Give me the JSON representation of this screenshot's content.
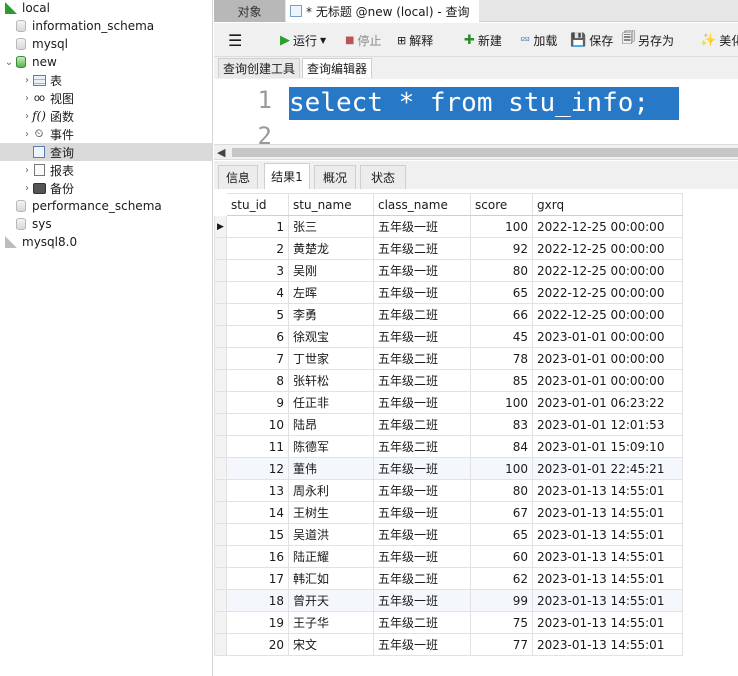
{
  "nav": {
    "items": [
      {
        "label": "local",
        "level": 0,
        "icon": "connection-green-icon",
        "expanded": true
      },
      {
        "label": "information_schema",
        "level": 1,
        "icon": "database-icon"
      },
      {
        "label": "mysql",
        "level": 1,
        "icon": "database-icon"
      },
      {
        "label": "new",
        "level": 1,
        "icon": "database-green-icon",
        "expanded": true
      },
      {
        "label": "表",
        "level": 2,
        "icon": "table-icon"
      },
      {
        "label": "视图",
        "level": 2,
        "icon": "view-icon"
      },
      {
        "label": "函数",
        "level": 2,
        "icon": "function-icon"
      },
      {
        "label": "事件",
        "level": 2,
        "icon": "event-icon"
      },
      {
        "label": "查询",
        "level": 2,
        "icon": "query-icon",
        "selected": true
      },
      {
        "label": "报表",
        "level": 2,
        "icon": "report-icon"
      },
      {
        "label": "备份",
        "level": 2,
        "icon": "backup-icon"
      },
      {
        "label": "performance_schema",
        "level": 1,
        "icon": "database-icon"
      },
      {
        "label": "sys",
        "level": 1,
        "icon": "database-icon"
      },
      {
        "label": "mysql8.0",
        "level": 0,
        "icon": "connection-gray-icon"
      }
    ]
  },
  "tabs": {
    "objects": "对象",
    "query": "* 无标题 @new (local) - 查询"
  },
  "toolbar": {
    "menu": "☰",
    "run": "运行",
    "stop": "停止",
    "explain": "解释",
    "new": "新建",
    "load": "加载",
    "save": "保存",
    "save_as": "另存为",
    "beautify": "美化"
  },
  "subtabs": {
    "builder": "查询创建工具",
    "editor": "查询编辑器"
  },
  "editor": {
    "line1": "1",
    "line2": "2",
    "code": "select * from stu_info;"
  },
  "result_tabs": {
    "info": "信息",
    "result1": "结果1",
    "profile": "概况",
    "status": "状态"
  },
  "grid": {
    "columns": [
      "stu_id",
      "stu_name",
      "class_name",
      "score",
      "gxrq"
    ],
    "rows": [
      [
        "1",
        "张三",
        "五年级一班",
        "100",
        "2022-12-25 00:00:00"
      ],
      [
        "2",
        "黄楚龙",
        "五年级二班",
        "92",
        "2022-12-25 00:00:00"
      ],
      [
        "3",
        "吴刚",
        "五年级一班",
        "80",
        "2022-12-25 00:00:00"
      ],
      [
        "4",
        "左晖",
        "五年级一班",
        "65",
        "2022-12-25 00:00:00"
      ],
      [
        "5",
        "李勇",
        "五年级二班",
        "66",
        "2022-12-25 00:00:00"
      ],
      [
        "6",
        "徐观宝",
        "五年级一班",
        "45",
        "2023-01-01 00:00:00"
      ],
      [
        "7",
        "丁世家",
        "五年级二班",
        "78",
        "2023-01-01 00:00:00"
      ],
      [
        "8",
        "张轩松",
        "五年级二班",
        "85",
        "2023-01-01 00:00:00"
      ],
      [
        "9",
        "任正非",
        "五年级一班",
        "100",
        "2023-01-01 06:23:22"
      ],
      [
        "10",
        "陆昂",
        "五年级二班",
        "83",
        "2023-01-01 12:01:53"
      ],
      [
        "11",
        "陈德军",
        "五年级二班",
        "84",
        "2023-01-01 15:09:10"
      ],
      [
        "12",
        "董伟",
        "五年级一班",
        "100",
        "2023-01-01 22:45:21"
      ],
      [
        "13",
        "周永利",
        "五年级一班",
        "80",
        "2023-01-13 14:55:01"
      ],
      [
        "14",
        "王树生",
        "五年级一班",
        "67",
        "2023-01-13 14:55:01"
      ],
      [
        "15",
        "吴道洪",
        "五年级一班",
        "65",
        "2023-01-13 14:55:01"
      ],
      [
        "16",
        "陆正耀",
        "五年级一班",
        "60",
        "2023-01-13 14:55:01"
      ],
      [
        "17",
        "韩汇如",
        "五年级二班",
        "62",
        "2023-01-13 14:55:01"
      ],
      [
        "18",
        "曾开天",
        "五年级一班",
        "99",
        "2023-01-13 14:55:01"
      ],
      [
        "19",
        "王子华",
        "五年级二班",
        "75",
        "2023-01-13 14:55:01"
      ],
      [
        "20",
        "宋文",
        "五年级一班",
        "77",
        "2023-01-13 14:55:01"
      ]
    ],
    "current_row_marker": "▶",
    "highlight_rows": [
      12,
      18
    ]
  }
}
